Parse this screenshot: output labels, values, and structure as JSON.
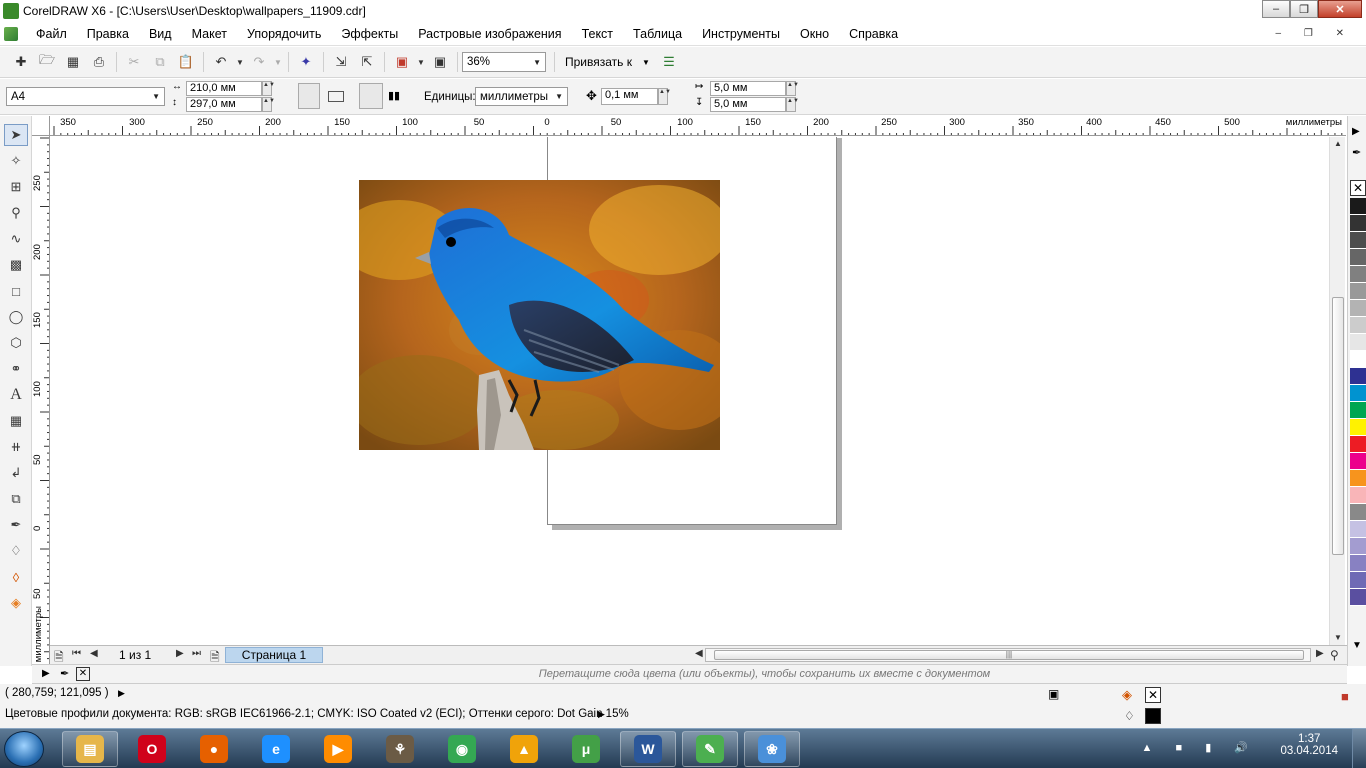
{
  "window": {
    "title": "CorelDRAW X6 - [C:\\Users\\User\\Desktop\\wallpapers_11909.cdr]",
    "minimize": "–",
    "maximize": "❐",
    "close": "✕"
  },
  "menu": {
    "items": [
      "Файл",
      "Правка",
      "Вид",
      "Макет",
      "Упорядочить",
      "Эффекты",
      "Растровые изображения",
      "Текст",
      "Таблица",
      "Инструменты",
      "Окно",
      "Справка"
    ],
    "doc_controls": "– ❐ ✕"
  },
  "toolbar": {
    "zoom": "36%",
    "snap_label": "Привязать к"
  },
  "properties": {
    "paper_size": "A4",
    "width": "210,0 мм",
    "height": "297,0 мм",
    "units_label": "Единицы:",
    "units_value": "миллиметры",
    "nudge": "0,1 мм",
    "dup_x": "5,0 мм",
    "dup_y": "5,0 мм"
  },
  "ruler": {
    "unit": "миллиметры",
    "h_ticks": [
      "350",
      "300",
      "250",
      "200",
      "150",
      "100",
      "50",
      "0",
      "50",
      "100",
      "150",
      "200",
      "250",
      "300",
      "350",
      "400",
      "450",
      "500"
    ],
    "v_ticks": [
      "250",
      "200",
      "150",
      "100",
      "50",
      "0",
      "50"
    ]
  },
  "pagenav": {
    "count": "1 из 1",
    "tab": "Страница 1"
  },
  "docpalette": {
    "hint": "Перетащите сюда цвета (или объекты), чтобы сохранить их вместе с документом"
  },
  "status": {
    "coords": "( 280,759; 121,095 )",
    "profiles": "Цветовые профили документа: RGB: sRGB IEC61966-2.1; CMYK: ISO Coated v2 (ECI); Оттенки серого: Dot Gain 15%"
  },
  "palette_colors": [
    "#1a1a1a",
    "#333333",
    "#4d4d4d",
    "#666666",
    "#808080",
    "#999999",
    "#b3b3b3",
    "#cccccc",
    "#e6e6e6",
    "#ffffff",
    "#2e3192",
    "#0093d0",
    "#00a651",
    "#fff200",
    "#ed1c24",
    "#ec008c",
    "#f7941d",
    "#f9b5b8",
    "#898989",
    "#c5c1e3",
    "#a39cd0",
    "#8881c2",
    "#6f6ab5",
    "#5a4fa0"
  ],
  "taskbar": {
    "time": "1:37",
    "date": "03.04.2014",
    "apps": [
      {
        "name": "explorer-icon",
        "color": "#e6b64a",
        "glyph": "▤"
      },
      {
        "name": "opera-icon",
        "color": "#d0021b",
        "glyph": "O"
      },
      {
        "name": "firefox-icon",
        "color": "#e66000",
        "glyph": "●"
      },
      {
        "name": "ie-icon",
        "color": "#1e90ff",
        "glyph": "e"
      },
      {
        "name": "media-player-icon",
        "color": "#ff8c00",
        "glyph": "▶"
      },
      {
        "name": "gimp-icon",
        "color": "#6b5b45",
        "glyph": "⚘"
      },
      {
        "name": "chrome-icon",
        "color": "#34a853",
        "glyph": "◉"
      },
      {
        "name": "aimp-icon",
        "color": "#f0a30a",
        "glyph": "▲"
      },
      {
        "name": "utorrent-icon",
        "color": "#43a047",
        "glyph": "μ"
      },
      {
        "name": "word-icon",
        "color": "#2b579a",
        "glyph": "W"
      },
      {
        "name": "coreldraw-icon",
        "color": "#4caf50",
        "glyph": "✎"
      },
      {
        "name": "paint-icon",
        "color": "#4a90d9",
        "glyph": "❀"
      }
    ]
  }
}
